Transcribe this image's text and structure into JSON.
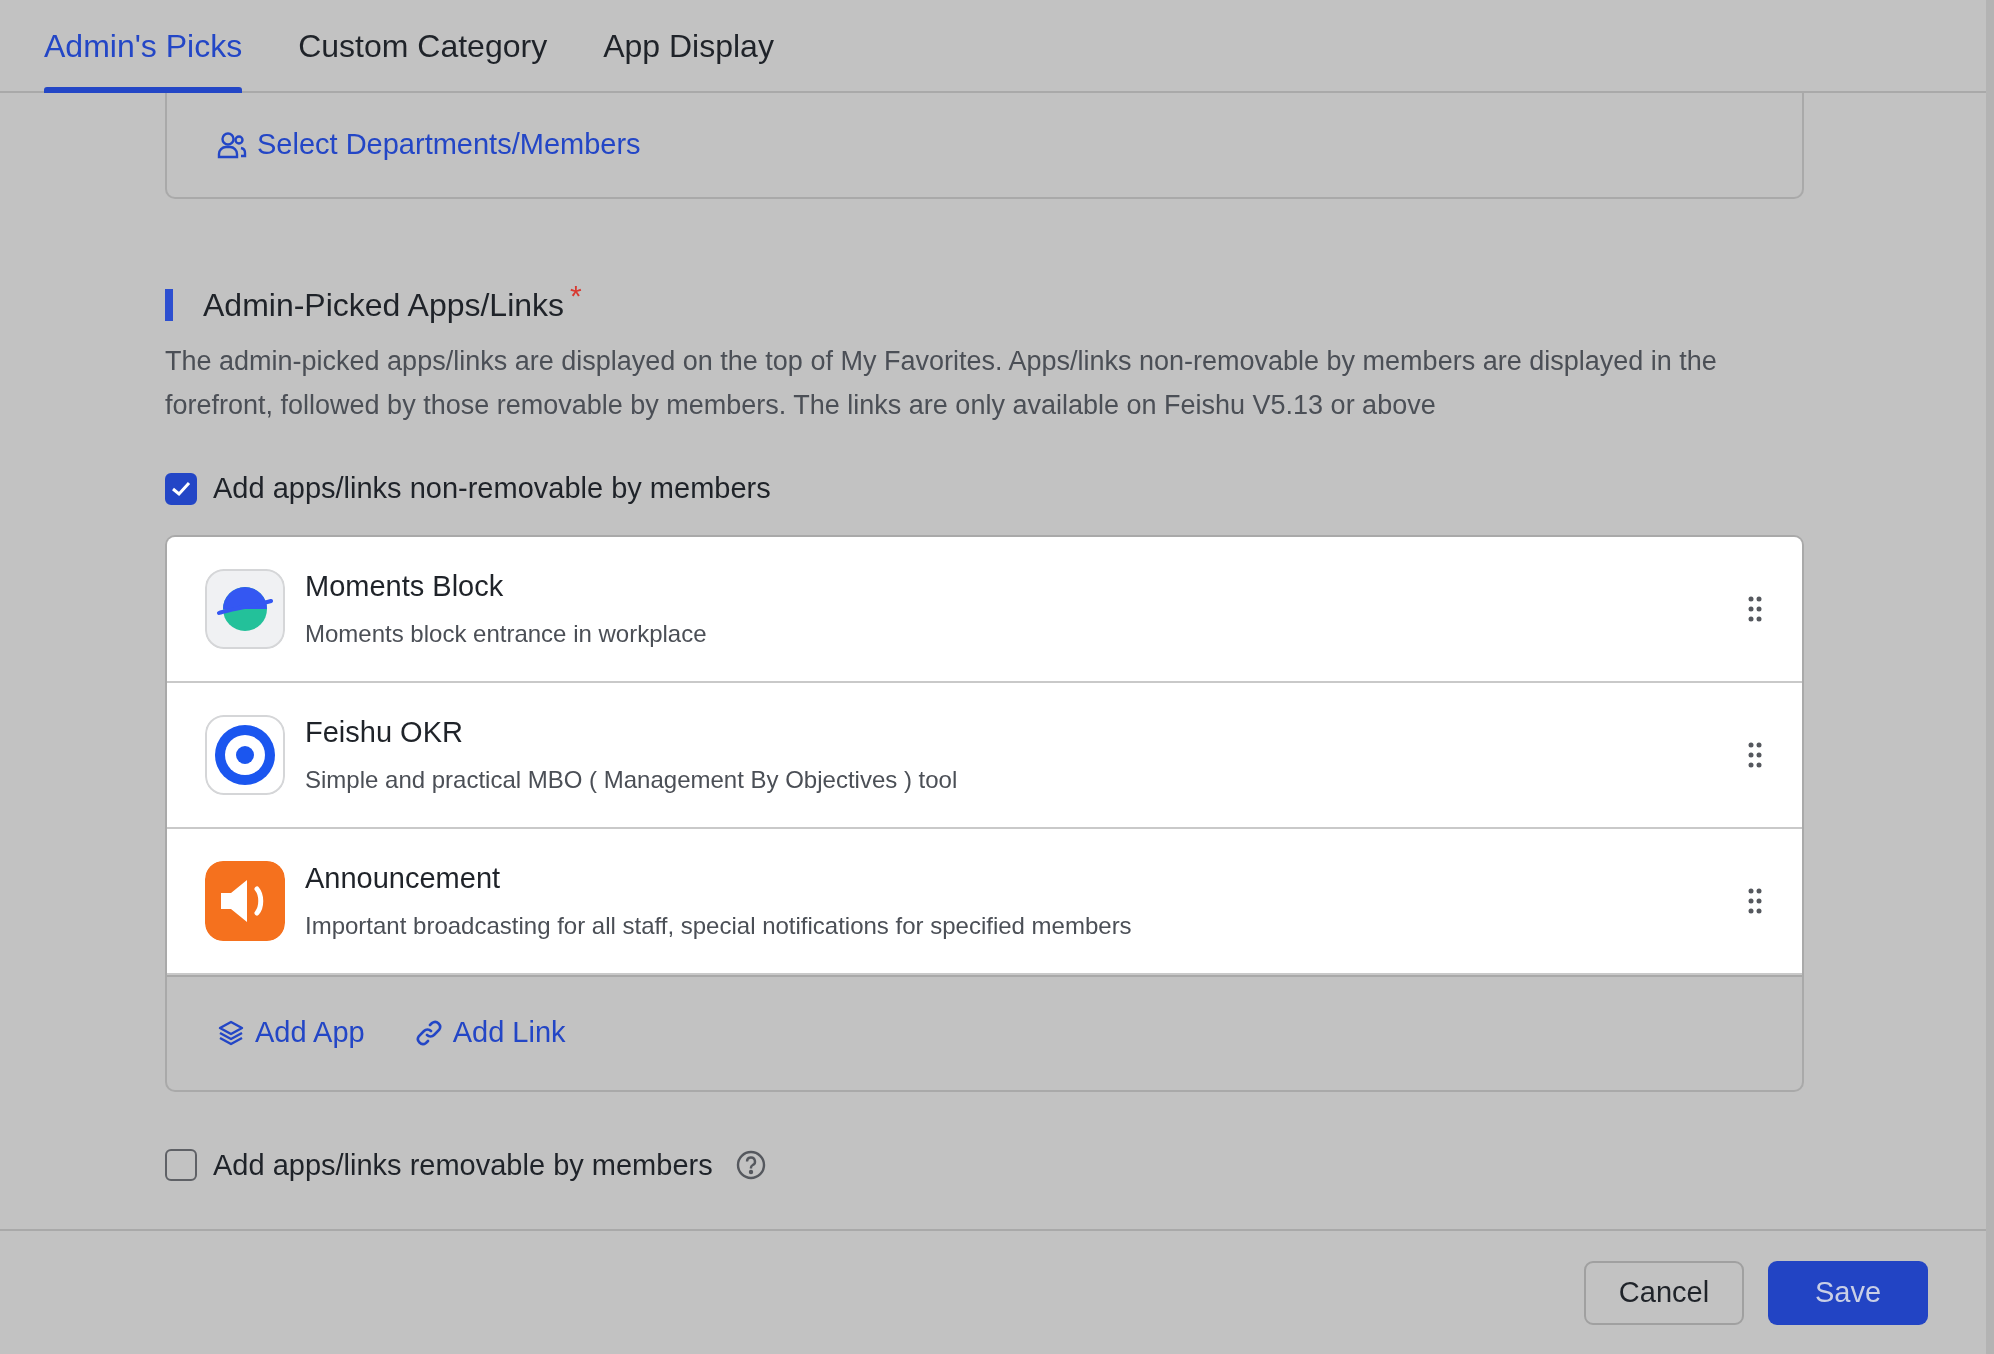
{
  "tabs": [
    {
      "label": "Admin's Picks",
      "selected": true
    },
    {
      "label": "Custom Category",
      "selected": false
    },
    {
      "label": "App Display",
      "selected": false
    }
  ],
  "members_link": "Select Departments/Members",
  "section": {
    "title": "Admin-Picked Apps/Links",
    "required_mark": "*",
    "description": "The admin-picked apps/links are displayed on the top of My Favorites. Apps/links non-removable by members are displayed in the forefront, followed by those removable by members. The links are only available on Feishu V5.13 or above"
  },
  "non_removable": {
    "label": "Add apps/links non-removable by members",
    "checked": true,
    "apps": [
      {
        "kind": "planet",
        "name": "Moments Block",
        "description": "Moments block entrance in workplace"
      },
      {
        "kind": "target",
        "name": "Feishu OKR",
        "description": "Simple and practical MBO ( Management By Objectives ) tool"
      },
      {
        "kind": "speaker",
        "name": "Announcement",
        "description": "Important broadcasting for all staff, special notifications for specified members"
      }
    ],
    "actions": [
      {
        "kind": "app",
        "label": "Add App"
      },
      {
        "kind": "link",
        "label": "Add Link"
      }
    ]
  },
  "removable": {
    "label": "Add apps/links removable by members",
    "checked": false
  },
  "buttons": [
    {
      "kind": "secondary",
      "label": "Cancel"
    },
    {
      "kind": "primary",
      "label": "Save"
    }
  ]
}
